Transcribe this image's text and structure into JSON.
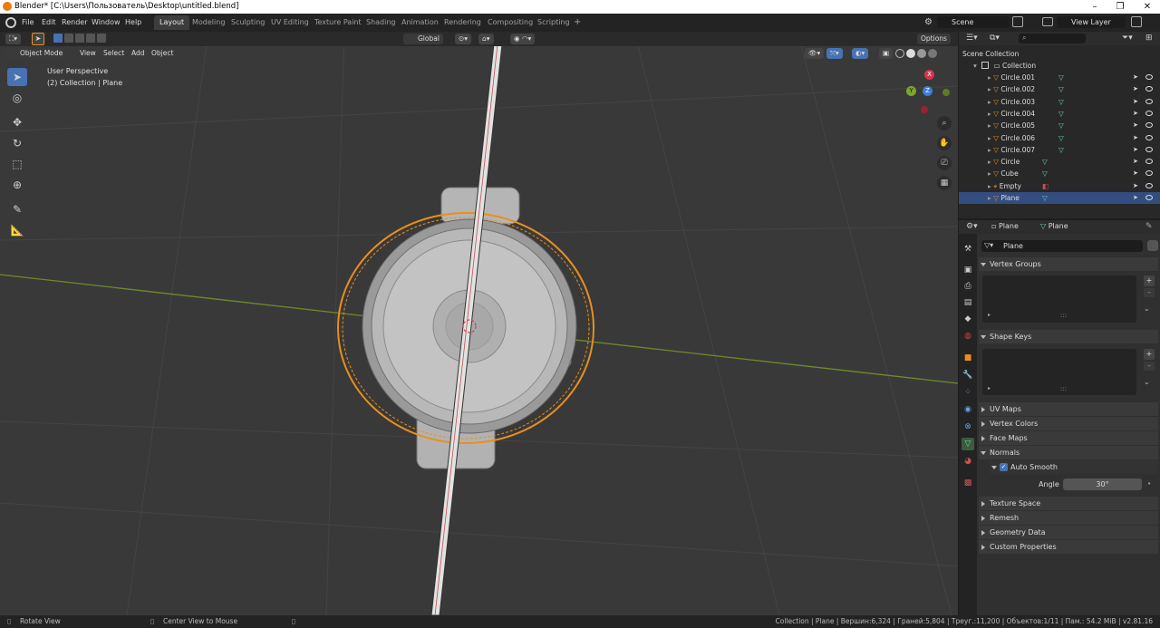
{
  "window": {
    "title": "Blender* [C:\\Users\\Пользователь\\Desktop\\untitled.blend]",
    "minimize": "–",
    "maximize": "❐",
    "close": "✕"
  },
  "menus": [
    "File",
    "Edit",
    "Render",
    "Window",
    "Help"
  ],
  "workspaces": [
    "Layout",
    "Modeling",
    "Sculpting",
    "UV Editing",
    "Texture Paint",
    "Shading",
    "Animation",
    "Rendering",
    "Compositing",
    "Scripting"
  ],
  "add_workspace": "+",
  "scene": "Scene",
  "view_layer": "View Layer",
  "viewport": {
    "mode": "Object Mode",
    "menus": [
      "View",
      "Select",
      "Add",
      "Object"
    ],
    "orientation": "Global",
    "options": "Options",
    "overlay_title": "User Perspective",
    "overlay_subtitle": "(2) Collection | Plane",
    "gizmo": {
      "x": "X",
      "y": "Y",
      "z": "Z"
    }
  },
  "outliner": {
    "scene_collection": "Scene Collection",
    "collection": "Collection",
    "items": [
      "Circle.001",
      "Circle.002",
      "Circle.003",
      "Circle.004",
      "Circle.005",
      "Circle.006",
      "Circle.007",
      "Circle",
      "Cube",
      "Empty",
      "Plane"
    ],
    "selected": "Plane"
  },
  "properties": {
    "object": "Plane",
    "data": "Plane",
    "mesh_name": "Plane",
    "panels_open": [
      "Vertex Groups",
      "Shape Keys"
    ],
    "panels": [
      "UV Maps",
      "Vertex Colors",
      "Face Maps"
    ],
    "normals": "Normals",
    "auto_smooth": "Auto Smooth",
    "angle_label": "Angle",
    "angle_value": "30°",
    "panels_after": [
      "Texture Space",
      "Remesh",
      "Geometry Data",
      "Custom Properties"
    ],
    "list_dots": ":::"
  },
  "status": {
    "rotate": "Rotate View",
    "center": "Center View to Mouse",
    "info": "Collection | Plane | Вершин:6,324 | Граней:5,804 | Треуг.:11,200 | Объектов:1/11 | Пам.: 54.2 MiB | v2.81.16"
  },
  "colors": {
    "accent": "#4772b3",
    "selection": "#e8901e",
    "x_axis": "#d4344a",
    "y_axis": "#7ba62c",
    "z_axis": "#3b7dd8"
  }
}
